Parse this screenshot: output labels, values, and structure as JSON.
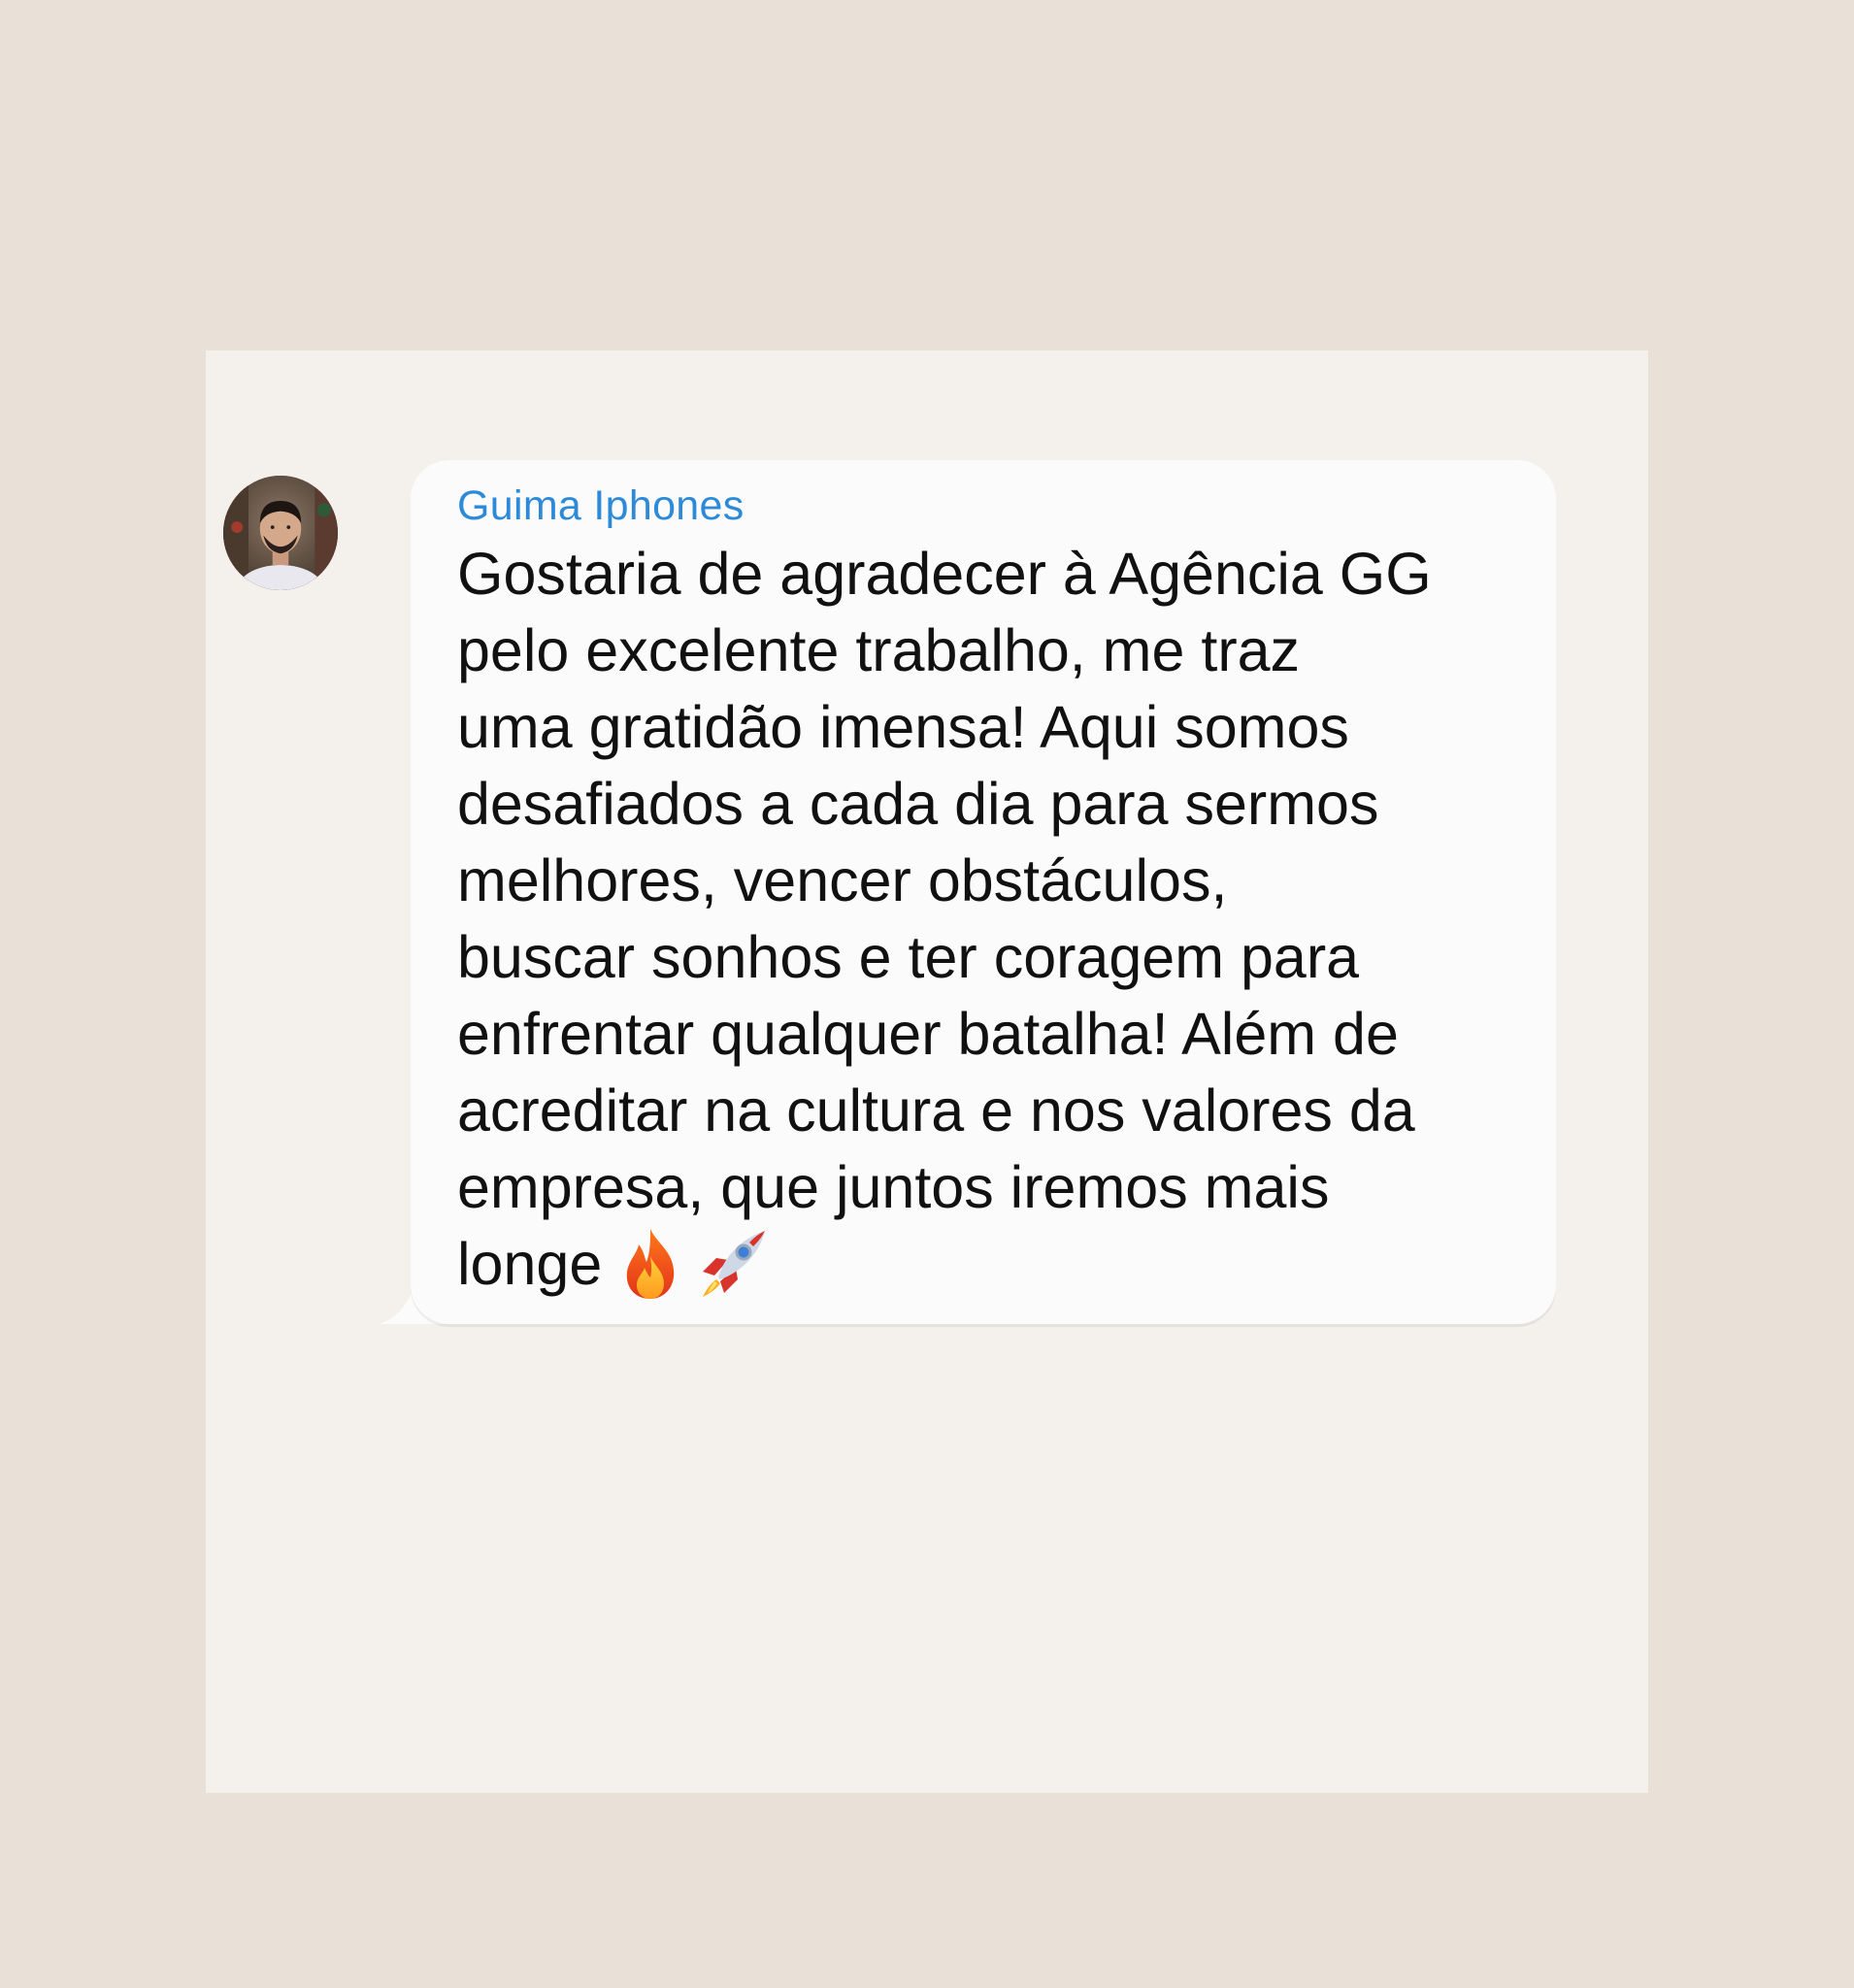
{
  "chat": {
    "sender_name": "Guima Iphones",
    "message_lines": [
      "Gostaria de agradecer à Agência GG",
      "pelo excelente trabalho, me traz",
      "uma gratidão imensa! Aqui somos",
      "desafiados a cada dia para sermos",
      "melhores, vencer obstáculos,",
      "buscar sonhos e ter coragem para",
      "enfrentar qualquer batalha! Além de",
      "acreditar na cultura e nos valores da",
      "empresa, que juntos iremos mais",
      "longe"
    ],
    "emojis": [
      "fire-icon",
      "rocket-icon"
    ]
  },
  "colors": {
    "page_background": "#e9e1d8",
    "card_background": "#f4f0eb",
    "bubble_background": "#fbfbfb",
    "sender_name": "#2d8ad8",
    "message_text": "#111111"
  }
}
